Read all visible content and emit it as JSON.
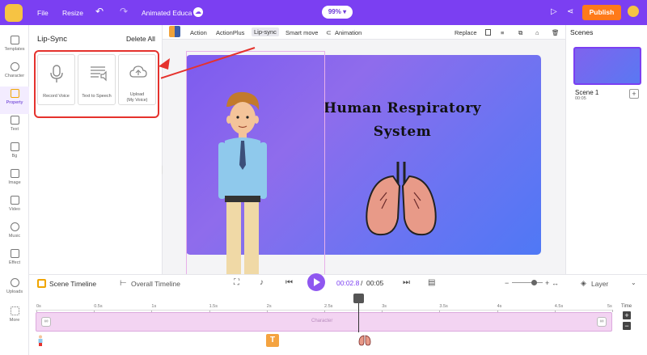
{
  "topbar": {
    "file_label": "File",
    "resize_label": "Resize",
    "project_name": "Animated Educa",
    "zoom": "99%",
    "publish_label": "Publish"
  },
  "leftnav": {
    "items": [
      {
        "label": "Templates"
      },
      {
        "label": "Character"
      },
      {
        "label": "Property"
      },
      {
        "label": "Text"
      },
      {
        "label": "Bg"
      },
      {
        "label": "Image"
      },
      {
        "label": "Video"
      },
      {
        "label": "Music"
      },
      {
        "label": "Effect"
      },
      {
        "label": "Uploads"
      },
      {
        "label": "More"
      }
    ]
  },
  "panel": {
    "title": "Lip-Sync",
    "delete_all": "Delete All",
    "options": [
      {
        "label": "Record Voice",
        "icon": "microphone-icon"
      },
      {
        "label": "Text to Speech",
        "icon": "text-speech-icon"
      },
      {
        "label": "Upload",
        "sub": "(My Voice)",
        "icon": "cloud-upload-icon"
      }
    ]
  },
  "toolbar": {
    "tabs": [
      "Action",
      "ActionPlus",
      "Lip-sync",
      "Smart move",
      "Animation"
    ],
    "active_tab": "Lip-sync",
    "replace_label": "Replace"
  },
  "slide": {
    "title_line1": "Human Respiratory",
    "title_line2": "System"
  },
  "scenes": {
    "header": "Scenes",
    "scene_name": "Scene 1",
    "scene_duration": "00:05"
  },
  "timeline": {
    "scene_timeline": "Scene Timeline",
    "overall_timeline": "Overall Timeline",
    "current_time": "00:02.8",
    "separator": "/",
    "total_time": "00:05",
    "layer_label": "Layer",
    "time_label": "Time",
    "ticks": [
      "0s",
      "0.5s",
      "1s",
      "1.5s",
      "2s",
      "2.5s",
      "3s",
      "3.5s",
      "4s",
      "4.5s",
      "5s"
    ],
    "track_label": "Character",
    "text_badge": "T"
  },
  "colors": {
    "brand": "#7b3ff2",
    "publish": "#ff7a1a",
    "highlight": "#e5322d"
  }
}
